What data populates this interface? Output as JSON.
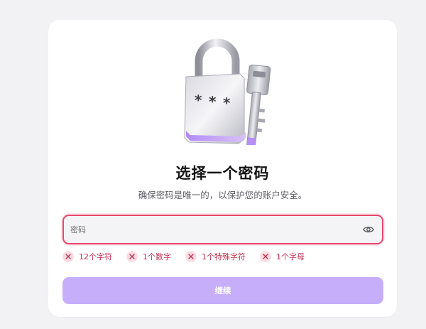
{
  "header": {
    "title": "选择一个密码",
    "subtitle": "确保密码是唯一的，以保护您的账户安全。"
  },
  "password_field": {
    "placeholder": "密码",
    "value": ""
  },
  "requirements": [
    {
      "label": "12个字符",
      "status": "unmet"
    },
    {
      "label": "1个数字",
      "status": "unmet"
    },
    {
      "label": "1个特殊字符",
      "status": "unmet"
    },
    {
      "label": "1个字母",
      "status": "unmet"
    }
  ],
  "continue_button": {
    "label": "继续",
    "state": "disabled"
  },
  "colors": {
    "error": "#e8466c",
    "error_text": "#c72f52",
    "button_disabled": "#c6aefb",
    "accent_purple": "#a784f2"
  },
  "icons": {
    "illustration": "padlock-key-illustration",
    "password_toggle": "eye-icon",
    "requirement_status": "x-icon"
  }
}
